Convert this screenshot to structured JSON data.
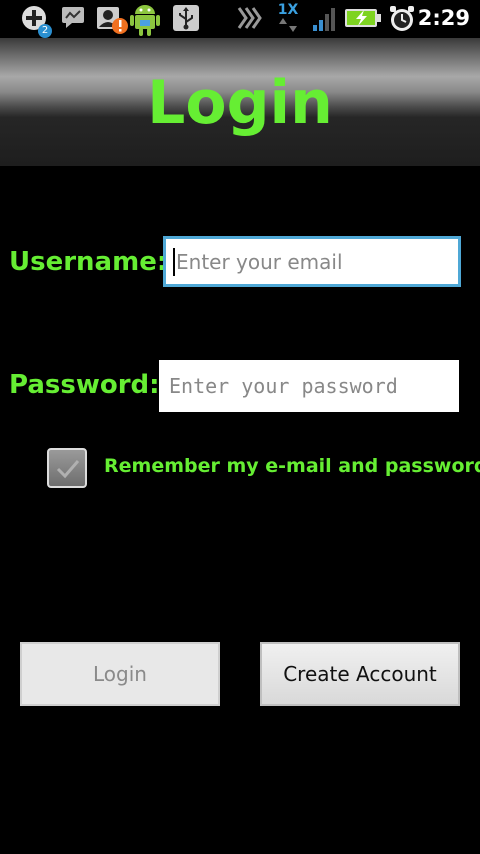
{
  "status_bar": {
    "notification_badge": "2",
    "network_type": "1X",
    "time": "2:29",
    "icons": [
      "add-icon",
      "messaging-icon",
      "contact-alert-icon",
      "android-icon",
      "usb-icon",
      "sync-icon",
      "signal-icon",
      "battery-charging-icon",
      "alarm-icon"
    ]
  },
  "header": {
    "title": "Login"
  },
  "form": {
    "username_label": "Username:",
    "username_placeholder": "Enter your email",
    "username_value": "",
    "password_label": "Password:",
    "password_placeholder": "Enter your password",
    "password_value": "",
    "remember_label": "Remember my e-mail and password",
    "remember_checked": false
  },
  "buttons": {
    "login_label": "Login",
    "create_account_label": "Create Account"
  },
  "colors": {
    "accent_green": "#66ee33",
    "focus_blue": "#4fa8d6"
  }
}
